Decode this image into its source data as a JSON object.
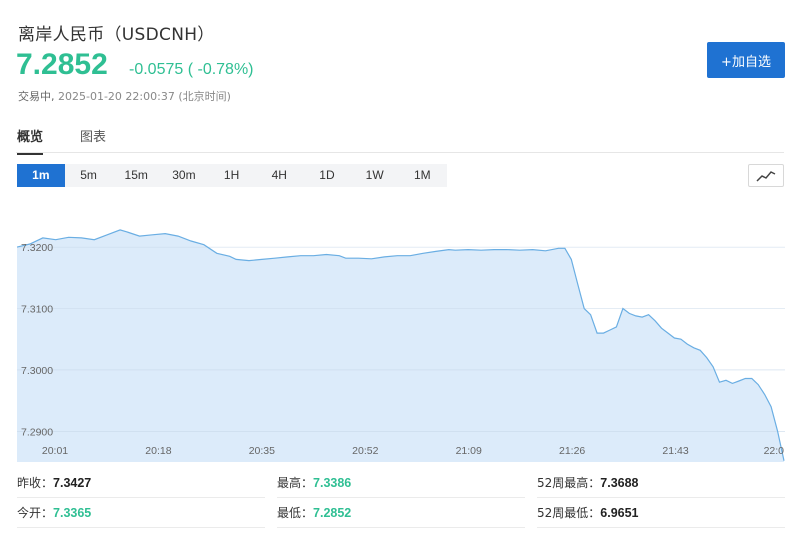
{
  "header": {
    "title": "离岸人民币（USDCNH）",
    "price": "7.2852",
    "change": "-0.0575 ( -0.78%)",
    "status": "交易中,",
    "timestamp": "2025-01-20 22:00:37 (北京时间)",
    "add_watchlist_label": "+加自选"
  },
  "tabs": [
    {
      "label": "概览",
      "active": true
    },
    {
      "label": "图表",
      "active": false
    }
  ],
  "intervals": [
    "1m",
    "5m",
    "15m",
    "30m",
    "1H",
    "4H",
    "1D",
    "1W",
    "1M"
  ],
  "active_interval": "1m",
  "colors": {
    "accent_blue": "#1f72d2",
    "price_green": "#2fbf93",
    "chart_line": "#6aaee3",
    "chart_fill": "#dcebfa"
  },
  "chart_data": {
    "type": "area",
    "y_ticks": [
      "7.3200",
      "7.3100",
      "7.3000",
      "7.2900"
    ],
    "ylim": [
      7.285,
      7.328
    ],
    "x_ticks": [
      "20:01",
      "20:18",
      "20:35",
      "20:52",
      "21:09",
      "21:26",
      "21:43",
      "22:0"
    ],
    "grid": true,
    "x": [
      "20:01",
      "20:03",
      "20:05",
      "20:07",
      "20:09",
      "20:11",
      "20:13",
      "20:15",
      "20:17",
      "20:18",
      "20:20",
      "20:22",
      "20:24",
      "20:26",
      "20:28",
      "20:30",
      "20:32",
      "20:34",
      "20:35",
      "20:37",
      "20:39",
      "20:41",
      "20:43",
      "20:45",
      "20:47",
      "20:49",
      "20:51",
      "20:52",
      "20:54",
      "20:56",
      "20:58",
      "21:00",
      "21:02",
      "21:04",
      "21:06",
      "21:08",
      "21:09",
      "21:11",
      "21:13",
      "21:15",
      "21:17",
      "21:19",
      "21:21",
      "21:23",
      "21:25",
      "21:26",
      "21:27",
      "21:28",
      "21:29",
      "21:30",
      "21:31",
      "21:32",
      "21:33",
      "21:34",
      "21:35",
      "21:36",
      "21:37",
      "21:38",
      "21:39",
      "21:40",
      "21:41",
      "21:42",
      "21:43",
      "21:44",
      "21:45",
      "21:46",
      "21:47",
      "21:48",
      "21:49",
      "21:50",
      "21:51",
      "21:52",
      "21:53",
      "21:54",
      "21:55",
      "21:56",
      "21:57",
      "21:58",
      "21:59",
      "22:00"
    ],
    "values": [
      7.32,
      7.3205,
      7.3215,
      7.3212,
      7.3216,
      7.3215,
      7.3212,
      7.322,
      7.3228,
      7.3225,
      7.3218,
      7.322,
      7.3222,
      7.3218,
      7.321,
      7.3204,
      7.319,
      7.3185,
      7.318,
      7.3178,
      7.318,
      7.3182,
      7.3184,
      7.3186,
      7.3186,
      7.3188,
      7.3186,
      7.3182,
      7.3182,
      7.3181,
      7.3184,
      7.3186,
      7.3186,
      7.319,
      7.3193,
      7.3196,
      7.3195,
      7.3196,
      7.3195,
      7.3196,
      7.3196,
      7.3195,
      7.3196,
      7.3194,
      7.3198,
      7.3198,
      7.318,
      7.314,
      7.31,
      7.309,
      7.306,
      7.306,
      7.3065,
      7.307,
      7.31,
      7.3092,
      7.3088,
      7.3086,
      7.309,
      7.308,
      7.3068,
      7.306,
      7.3052,
      7.305,
      7.3042,
      7.3036,
      7.3032,
      7.302,
      7.3005,
      7.298,
      7.2983,
      7.2978,
      7.2982,
      7.2986,
      7.2986,
      7.2976,
      7.296,
      7.294,
      7.29,
      7.2852
    ]
  },
  "stats": [
    [
      {
        "label": "昨收：",
        "value": "7.3427",
        "tone": "neu"
      },
      {
        "label": "最高：",
        "value": "7.3386",
        "tone": "up"
      },
      {
        "label": "52周最高：",
        "value": "7.3688",
        "tone": "neu"
      }
    ],
    [
      {
        "label": "今开：",
        "value": "7.3365",
        "tone": "up"
      },
      {
        "label": "最低：",
        "value": "7.2852",
        "tone": "up"
      },
      {
        "label": "52周最低：",
        "value": "6.9651",
        "tone": "neu"
      }
    ]
  ]
}
